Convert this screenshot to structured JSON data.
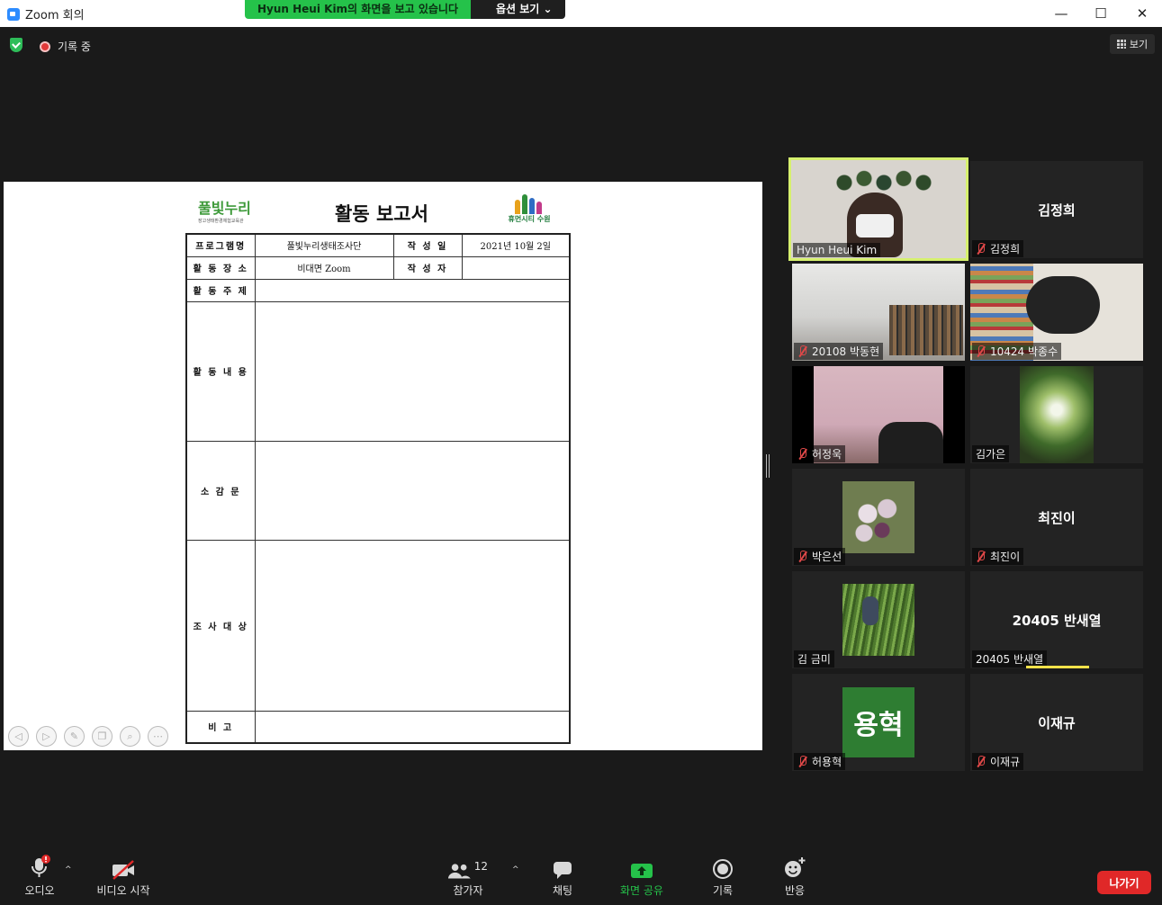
{
  "window": {
    "title": "Zoom 회의",
    "share_banner": "Hyun Heui Kim의 화면을 보고 있습니다",
    "options_label": "옵션 보기",
    "minimize": "—",
    "maximize": "☐",
    "close": "✕"
  },
  "status": {
    "recording_label": "기록 중",
    "view_label": "보기"
  },
  "document": {
    "title": "활동 보고서",
    "logo_left_text": "풀빛누리",
    "logo_left_sub": "장고생태환경체험교육관",
    "logo_right_text": "휴먼시티 수원",
    "rows": {
      "program_label": "프로그램명",
      "program_value": "풀빛누리생태조사단",
      "date_label": "작 성 일",
      "date_value": "2021년  10월  2일",
      "place_label": "활 동 장 소",
      "place_value": "비대면 Zoom",
      "author_label": "작 성 자",
      "author_value": "",
      "topic_label": "활 동 주 제",
      "content_label": "활 동 내 용",
      "impression_label": "소 감 문",
      "target_label": "조 사 대 상",
      "note_label": "비  고"
    }
  },
  "participants": [
    {
      "name": "Hyun Heui Kim",
      "muted": false,
      "video": true
    },
    {
      "name": "김정희",
      "center": "김정희",
      "muted": true,
      "video": false
    },
    {
      "name": "20108 박동현",
      "muted": true,
      "video": true
    },
    {
      "name": "10424 박종수",
      "muted": true,
      "video": true
    },
    {
      "name": "허정욱",
      "muted": true,
      "video": true
    },
    {
      "name": "김가은",
      "muted": false,
      "video": true
    },
    {
      "name": "박은선",
      "muted": true,
      "video": true
    },
    {
      "name": "최진이",
      "center": "최진이",
      "muted": true,
      "video": false
    },
    {
      "name": "김 금미",
      "muted": false,
      "video": true
    },
    {
      "name": "20405 반새열",
      "center": "20405 반새열",
      "muted": false,
      "video": false
    },
    {
      "name": "허용혁",
      "avatar_text": "용혁",
      "muted": true,
      "video": false
    },
    {
      "name": "이재규",
      "center": "이재규",
      "muted": true,
      "video": false
    }
  ],
  "toolbar": {
    "audio": "오디오",
    "video": "비디오 시작",
    "participants": "참가자",
    "participants_count": "12",
    "chat": "채팅",
    "share": "화면 공유",
    "record": "기록",
    "reactions": "반응",
    "leave": "나가기"
  },
  "colors": {
    "share_green": "#25c24a",
    "active_border": "#d6f06e",
    "leave_red": "#e02828",
    "avatar_green": "#2e7d32"
  }
}
